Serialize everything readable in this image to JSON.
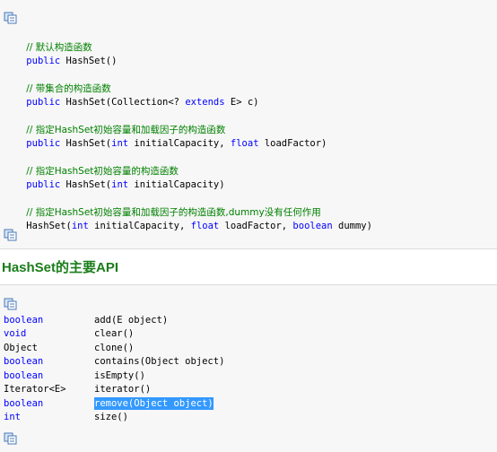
{
  "constructors": [
    {
      "comment": "// 默认构造函数",
      "decl": "public HashSet()"
    },
    {
      "comment": "// 带集合的构造函数",
      "decl": "public HashSet(Collection<? extends E> c)"
    },
    {
      "comment": "// 指定HashSet初始容量和加载因子的构造函数",
      "decl": "public HashSet(int initialCapacity, float loadFactor)"
    },
    {
      "comment": "// 指定HashSet初始容量的构造函数",
      "decl": "public HashSet(int initialCapacity)"
    },
    {
      "comment": "// 指定HashSet初始容量和加载因子的构造函数,dummy没有任何作用",
      "decl": "HashSet(int initialCapacity, float loadFactor, boolean dummy)"
    }
  ],
  "section_heading": "HashSet的主要API",
  "api": [
    {
      "type": "boolean",
      "method": "add(E object)"
    },
    {
      "type": "void",
      "method": "clear()"
    },
    {
      "type": "Object",
      "method": "clone()"
    },
    {
      "type": "boolean",
      "method": "contains(Object object)"
    },
    {
      "type": "boolean",
      "method": "isEmpty()"
    },
    {
      "type": "Iterator<E>",
      "method": "iterator()"
    },
    {
      "type": "boolean",
      "method": "remove(Object object)",
      "selected": true
    },
    {
      "type": "int",
      "method": "size()"
    }
  ],
  "icons": {
    "copy": "copy-code-icon"
  },
  "colors": {
    "comment": "#008000",
    "keyword": "#0000ff",
    "heading": "#1a7d1a",
    "selection": "#3399ff"
  }
}
